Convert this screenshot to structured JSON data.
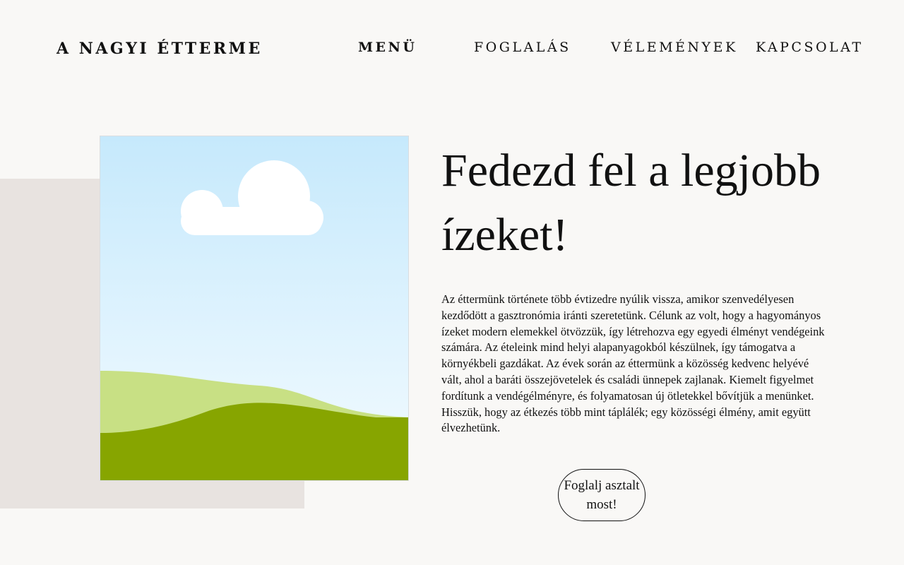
{
  "header": {
    "logo": "A NAGYI ÉTTERME",
    "nav": [
      {
        "label": "MENÜ",
        "active": true
      },
      {
        "label": "FOGLALÁS",
        "active": false
      },
      {
        "label": "VÉLEMÉNYEK",
        "active": false
      },
      {
        "label": "KAPCSOLAT",
        "active": false
      }
    ]
  },
  "hero": {
    "image_icon": "landscape-illustration",
    "heading": "Fedezd fel a legjobb ízeket!",
    "paragraph": "Az éttermünk története több évtizedre nyúlik vissza, amikor szenvedélyesen kezdődött a gasztronómia iránti szeretetünk. Célunk az volt, hogy a hagyományos ízeket modern elemekkel ötvözzük, így létrehozva egy egyedi élményt vendégeink számára. Az ételeink mind helyi alapanyagokból készülnek, így támogatva a környékbeli gazdákat. Az évek során az éttermünk a közösség kedvenc helyévé vált, ahol a baráti összejövetelek és családi ünnepek zajlanak. Kiemelt figyelmet fordítunk a vendégélményre, és folyamatosan új ötletekkel bővítjük a menünket. Hisszük, hogy az étkezés több mint táplálék; egy közösségi élmény, amit együtt élvezhetünk.",
    "cta_label": "Foglalj asztalt most!"
  },
  "colors": {
    "page_background": "#f9f8f6",
    "accent_block": "#e8e3e0",
    "sky_top": "#c6e9fc",
    "sky_bottom": "#f3fbff",
    "hill_light": "#c8e084",
    "hill_dark": "#87a500",
    "cloud": "#ffffff",
    "text": "#111111"
  }
}
